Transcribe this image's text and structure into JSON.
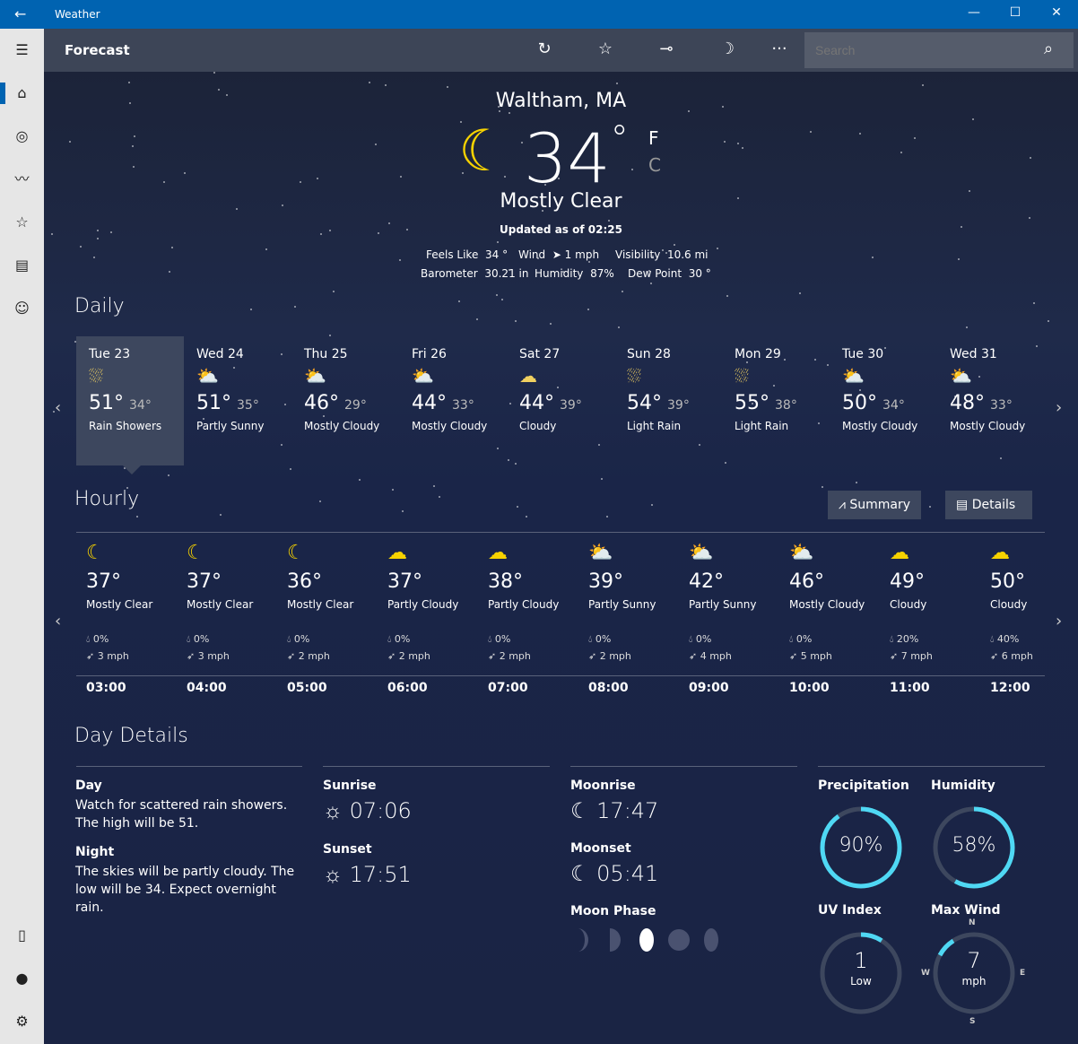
{
  "app": {
    "title": "Weather",
    "page": "Forecast",
    "search_placeholder": "Search"
  },
  "current": {
    "location": "Waltham, MA",
    "temp": "34",
    "deg": "°",
    "unit_f": "F",
    "unit_c": "C",
    "condition": "Mostly Clear",
    "updated": "Updated as of 02:25",
    "stats": [
      {
        "label": "Feels Like",
        "value": "34 °"
      },
      {
        "label": "Wind",
        "value": "➤ 1 mph"
      },
      {
        "label": "Visibility",
        "value": "10.6 mi"
      },
      {
        "label": "Barometer",
        "value": "30.21 in"
      },
      {
        "label": "Humidity",
        "value": "87%"
      },
      {
        "label": "Dew Point",
        "value": "30 °"
      }
    ]
  },
  "daily": {
    "title": "Daily",
    "days": [
      {
        "day": "Tue 23",
        "high": "51°",
        "low": "34°",
        "cond": "Rain Showers",
        "icon": "rain-showers"
      },
      {
        "day": "Wed 24",
        "high": "51°",
        "low": "35°",
        "cond": "Partly Sunny",
        "icon": "partly-sunny"
      },
      {
        "day": "Thu 25",
        "high": "46°",
        "low": "29°",
        "cond": "Mostly Cloudy",
        "icon": "mostly-cloudy"
      },
      {
        "day": "Fri 26",
        "high": "44°",
        "low": "33°",
        "cond": "Mostly Cloudy",
        "icon": "mostly-cloudy"
      },
      {
        "day": "Sat 27",
        "high": "44°",
        "low": "39°",
        "cond": "Cloudy",
        "icon": "cloudy"
      },
      {
        "day": "Sun 28",
        "high": "54°",
        "low": "39°",
        "cond": "Light Rain",
        "icon": "light-rain"
      },
      {
        "day": "Mon 29",
        "high": "55°",
        "low": "38°",
        "cond": "Light Rain",
        "icon": "light-rain"
      },
      {
        "day": "Tue 30",
        "high": "50°",
        "low": "34°",
        "cond": "Mostly Cloudy",
        "icon": "mostly-cloudy"
      },
      {
        "day": "Wed 31",
        "high": "48°",
        "low": "33°",
        "cond": "Mostly Cloudy",
        "icon": "mostly-cloudy"
      }
    ]
  },
  "hourly": {
    "title": "Hourly",
    "summary_label": "Summary",
    "details_label": "Details",
    "hours": [
      {
        "temp": "37°",
        "cond": "Mostly Clear",
        "precip": "0%",
        "wind": "3 mph",
        "time": "03:00",
        "icon": "moon"
      },
      {
        "temp": "37°",
        "cond": "Mostly Clear",
        "precip": "0%",
        "wind": "3 mph",
        "time": "04:00",
        "icon": "moon"
      },
      {
        "temp": "36°",
        "cond": "Mostly Clear",
        "precip": "0%",
        "wind": "2 mph",
        "time": "05:00",
        "icon": "moon"
      },
      {
        "temp": "37°",
        "cond": "Partly Cloudy",
        "precip": "0%",
        "wind": "2 mph",
        "time": "06:00",
        "icon": "partly-cloudy-night"
      },
      {
        "temp": "38°",
        "cond": "Partly Cloudy",
        "precip": "0%",
        "wind": "2 mph",
        "time": "07:00",
        "icon": "partly-cloudy-night"
      },
      {
        "temp": "39°",
        "cond": "Partly Sunny",
        "precip": "0%",
        "wind": "2 mph",
        "time": "08:00",
        "icon": "partly-sunny"
      },
      {
        "temp": "42°",
        "cond": "Partly Sunny",
        "precip": "0%",
        "wind": "4 mph",
        "time": "09:00",
        "icon": "partly-sunny"
      },
      {
        "temp": "46°",
        "cond": "Mostly Cloudy",
        "precip": "0%",
        "wind": "5 mph",
        "time": "10:00",
        "icon": "mostly-cloudy"
      },
      {
        "temp": "49°",
        "cond": "Cloudy",
        "precip": "20%",
        "wind": "7 mph",
        "time": "11:00",
        "icon": "cloudy"
      },
      {
        "temp": "50°",
        "cond": "Cloudy",
        "precip": "40%",
        "wind": "6 mph",
        "time": "12:00",
        "icon": "cloudy"
      }
    ]
  },
  "details": {
    "title": "Day Details",
    "day_label": "Day",
    "day_text": "Watch for scattered rain showers. The high will be 51.",
    "night_label": "Night",
    "night_text": "The skies will be partly cloudy. The low will be 34. Expect overnight rain.",
    "sunrise_label": "Sunrise",
    "sunrise": "07:06",
    "sunset_label": "Sunset",
    "sunset": "17:51",
    "moonrise_label": "Moonrise",
    "moonrise": "17:47",
    "moonset_label": "Moonset",
    "moonset": "05:41",
    "moon_phase_label": "Moon Phase",
    "precip_label": "Precipitation",
    "precip": "90%",
    "precip_fraction": 0.9,
    "humidity_label": "Humidity",
    "humidity": "58%",
    "humidity_fraction": 0.58,
    "uv_label": "UV Index",
    "uv": "1",
    "uv_text": "Low",
    "uv_fraction": 0.09,
    "wind_label": "Max Wind",
    "wind": "7",
    "wind_unit": "mph",
    "compass": {
      "n": "N",
      "e": "E",
      "s": "S",
      "w": "W"
    }
  },
  "colors": {
    "accent": "#0063b1",
    "gauge": "#4fd8f4",
    "gauge_track": "#3d475e"
  }
}
